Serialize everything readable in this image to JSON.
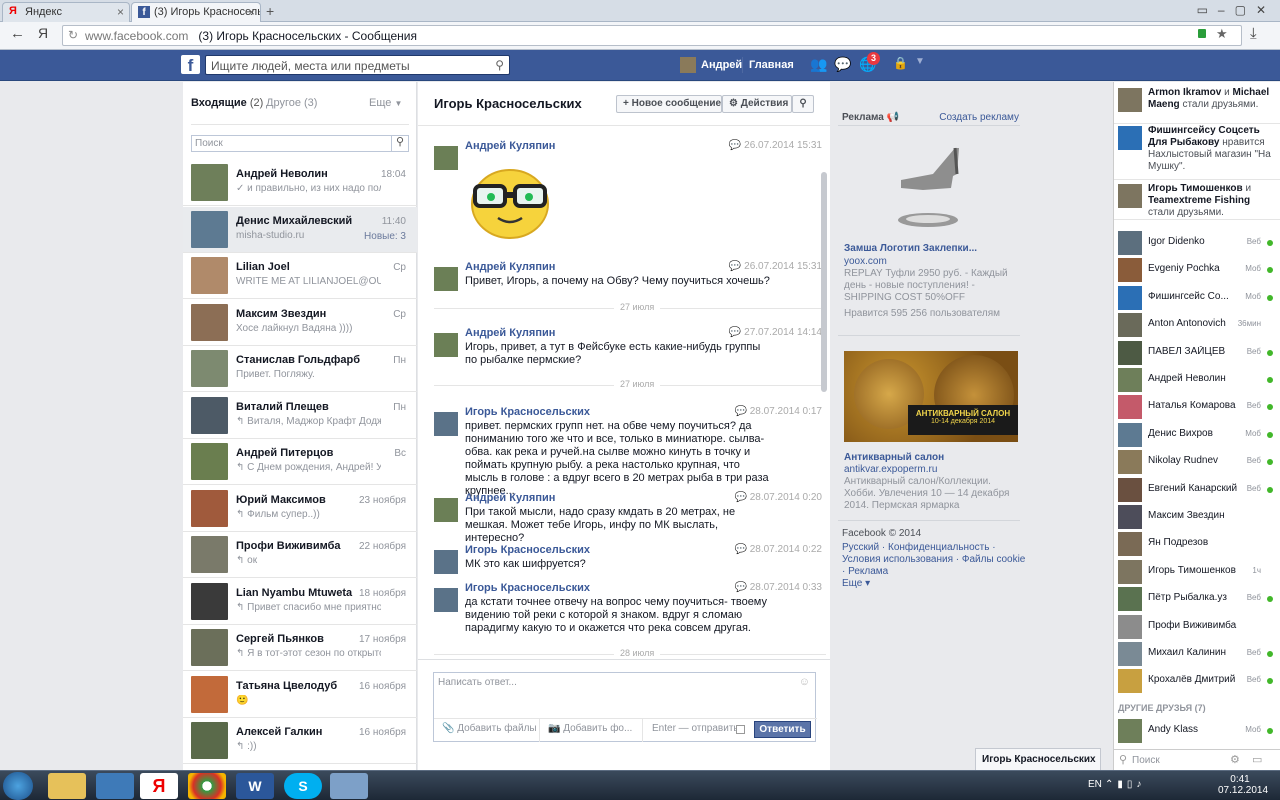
{
  "browser": {
    "tabs": [
      "Яндекс",
      "(3) Игорь Красносельских"
    ],
    "url_host": "www.facebook.com",
    "url_title": "(3) Игорь Красносельских - Сообщения",
    "yandex_letter": "Я"
  },
  "fbbar": {
    "search_placeholder": "Ищите людей, места или предметы",
    "user_name": "Андрей",
    "home": "Главная",
    "notif_count": "3",
    "logo": "f"
  },
  "inbox": {
    "tab_inbox": "Входящие",
    "inbox_count": "(2)",
    "tab_other": "Другое",
    "other_count": "(3)",
    "more": "Еще",
    "search_placeholder": "Поиск",
    "threads": [
      {
        "name": "Андрей Неволин",
        "snippet": "✓ и правильно, из них надо пол...",
        "time": "18:04",
        "extra": ""
      },
      {
        "name": "Денис Михайлевский",
        "snippet": "misha-studio.ru",
        "time": "11:40",
        "extra": "Новые: 3"
      },
      {
        "name": "Lilian Joel",
        "snippet": "WRITE ME AT LILIANJOEL@OU...",
        "time": "Ср",
        "extra": ""
      },
      {
        "name": "Максим Звездин",
        "snippet": "Хосе лайкнул Вадяна ))))",
        "time": "Ср",
        "extra": ""
      },
      {
        "name": "Станислав Гольдфарб",
        "snippet": "Привет. Погляжу.",
        "time": "Пн",
        "extra": ""
      },
      {
        "name": "Виталий Плещев",
        "snippet": "↰ Виталя, Маджор Крафт Додж...",
        "time": "Пн",
        "extra": ""
      },
      {
        "name": "Андрей Питерцов",
        "snippet": "↰ С Днем рождения, Андрей! У...",
        "time": "Вс",
        "extra": ""
      },
      {
        "name": "Юрий Максимов",
        "snippet": "↰ Фильм супер..))",
        "time": "23 ноября",
        "extra": ""
      },
      {
        "name": "Профи Виживимба",
        "snippet": "↰ ок",
        "time": "22 ноября",
        "extra": ""
      },
      {
        "name": "Lian Nyambu Mtuweta",
        "snippet": "↰ Привет спасибо мне приятно",
        "time": "18 ноября",
        "extra": ""
      },
      {
        "name": "Сергей Пьянков",
        "snippet": "↰ Я в тот-этот сезон по открыто...",
        "time": "17 ноября",
        "extra": ""
      },
      {
        "name": "Татьяна Цвелодуб",
        "snippet": "🙂",
        "time": "16 ноября",
        "extra": ""
      },
      {
        "name": "Алексей Галкин",
        "snippet": "↰ :))",
        "time": "16 ноября",
        "extra": ""
      }
    ]
  },
  "conversation": {
    "title": "Игорь Красносельских",
    "new_message": "Новое сообщение",
    "actions": "Действия",
    "messages": [
      {
        "author": "Андрей Куляпин",
        "date": "26.07.2014 15:31",
        "body": ""
      },
      {
        "author": "Андрей Куляпин",
        "date": "26.07.2014 15:31",
        "body": "Привет, Игорь, а почему на Обву? Чему поучиться хочешь?"
      },
      {
        "author": "Андрей Куляпин",
        "date": "27.07.2014 14:14",
        "body": "Игорь, привет, а тут в Фейсбуке есть какие-нибудь группы по рыбалке пермские?"
      },
      {
        "author": "Игорь Красносельских",
        "date": "28.07.2014 0:17",
        "body": "привет. пермских групп нет. на обве чему поучиться? да пониманию того же что и все, только в миниатюре. сылва- обва. как река и ручей.на сылве можно кинуть в точку и поймать крупную рыбу. а река настолько крупная, что мысль в голове : а вдруг всего в 20 метрах рыба  в три раза крупнее..."
      },
      {
        "author": "Андрей Куляпин",
        "date": "28.07.2014 0:20",
        "body": "При такой мысли, надо сразу кмдать в 20 метрах, не мешкая. Может тебе Игорь, инфу по МК выслать, интересно?"
      },
      {
        "author": "Игорь Красносельских",
        "date": "28.07.2014 0:22",
        "body": "МК это как шифруется?"
      },
      {
        "author": "Игорь Красносельских",
        "date": "28.07.2014 0:33",
        "body": "да кстати точнее отвечу на вопрос чему поучиться- твоему видению той реки с которой я знаком. вдруг я сломаю парадигму какую то  и окажется что река совсем другая."
      }
    ],
    "day_seps": [
      "27 июля",
      "27 июля",
      "28 июля"
    ],
    "reply_placeholder": "Написать ответ...",
    "add_files": "Добавить файлы",
    "add_photo": "Добавить фо...",
    "enter_send": "Enter — отправить",
    "reply_button": "Ответить"
  },
  "ads": {
    "header": "Реклама",
    "create": "Создать рекламу",
    "ad1_title": "Замша Логотип Заклепки...",
    "ad1_domain": "yoox.com",
    "ad1_text": "REPLAY Туфли 2950 руб. - Каждый день - новые поступления! - SHIPPING COST 50%OFF",
    "ad1_likes": "Нравится 595 256 пользователям",
    "ad2_banner_line1": "АНТИКВАРНЫЙ САЛОН",
    "ad2_banner_line2": "10-14 декабря 2014",
    "ad2_title": "Антикварный салон",
    "ad2_domain": "antikvar.expoperm.ru",
    "ad2_text": "Антикварный салон/Коллекции. Хобби. Увлечения 10 — 14 декабря 2014. Пермская ярмарка",
    "copyright": "Facebook © 2014",
    "footer_links": [
      "Русский",
      "Конфиденциальность",
      "Условия использования",
      "Файлы cookie",
      "Реклама",
      "Еще"
    ]
  },
  "chat": {
    "ticker": [
      {
        "bold": "Armon Ikramov",
        "mid": " и ",
        "bold2": "Michael Maeng",
        "rest": " стали друзьями."
      },
      {
        "bold": "Фишингсейсу Соцсеть Для Рыбакову",
        "mid": " нравится ",
        "bold2": "",
        "rest": "Нахлыстовый магазин \"На Мушку\"."
      },
      {
        "bold": "Игорь Тимошенков",
        "mid": " и ",
        "bold2": "Teamextreme Fishing",
        "rest": " стали друзьями."
      }
    ],
    "friends": [
      {
        "name": "Igor Didenko",
        "status": "Веб",
        "dot": true
      },
      {
        "name": "Evgeniy Pochka",
        "status": "Моб",
        "dot": true
      },
      {
        "name": "Фишингсейс Со...",
        "status": "Моб",
        "dot": true
      },
      {
        "name": "Anton Antonovich",
        "status": "36мин",
        "dot": false
      },
      {
        "name": "ПАВЕЛ ЗАЙЦЕВ",
        "status": "Веб",
        "dot": true
      },
      {
        "name": "Андрей Неволин",
        "status": "",
        "dot": true
      },
      {
        "name": "Наталья Комарова",
        "status": "Веб",
        "dot": true
      },
      {
        "name": "Денис Вихров",
        "status": "Моб",
        "dot": true
      },
      {
        "name": "Nikolay Rudnev",
        "status": "Веб",
        "dot": true
      },
      {
        "name": "Евгений Канарский",
        "status": "Веб",
        "dot": true
      },
      {
        "name": "Максим Звездин",
        "status": "",
        "dot": false
      },
      {
        "name": "Ян Подрезов",
        "status": "",
        "dot": false
      },
      {
        "name": "Игорь Тимошенков",
        "status": "1ч",
        "dot": false
      },
      {
        "name": "Пётр Рыбалка.уз",
        "status": "Веб",
        "dot": true
      },
      {
        "name": "Профи Виживимба",
        "status": "",
        "dot": false
      },
      {
        "name": "Михаил Калинин",
        "status": "Веб",
        "dot": true
      },
      {
        "name": "Крохалёв Дмитрий",
        "status": "Веб",
        "dot": true
      }
    ],
    "other_friends": "ДРУГИЕ ДРУЗЬЯ (7)",
    "other": [
      {
        "name": "Andy Klass",
        "status": "Моб",
        "dot": true
      }
    ],
    "search_placeholder": "Поиск",
    "chat_tab": "Игорь Красносельских"
  },
  "taskbar": {
    "lang": "EN",
    "time": "0:41",
    "date": "07.12.2014"
  },
  "colors": {
    "fb_blue": "#3b5998",
    "online": "#42b72a"
  }
}
